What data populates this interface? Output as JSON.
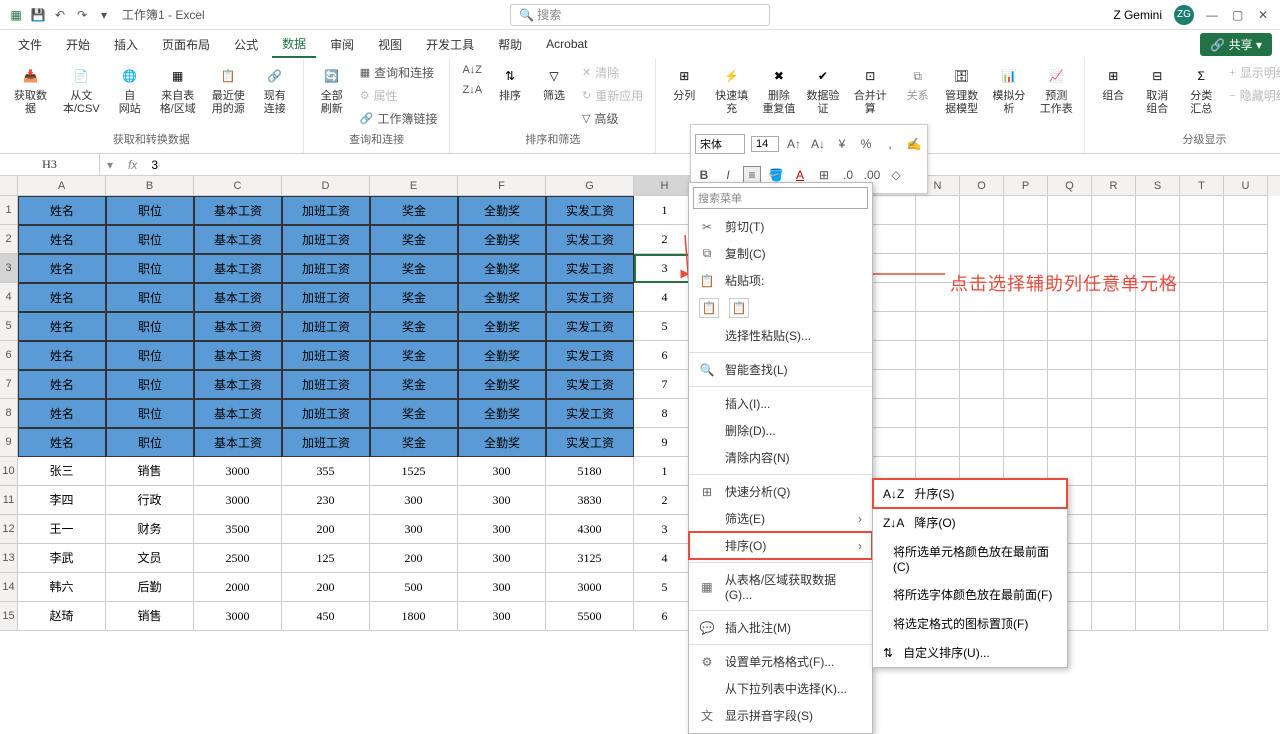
{
  "titlebar": {
    "title": "工作簿1 - Excel",
    "search_placeholder": "搜索",
    "user": "Z Gemini",
    "user_initials": "ZG"
  },
  "tabs": [
    "文件",
    "开始",
    "插入",
    "页面布局",
    "公式",
    "数据",
    "审阅",
    "视图",
    "开发工具",
    "帮助",
    "Acrobat"
  ],
  "active_tab": "数据",
  "share_label": "共享",
  "ribbon": {
    "g1_label": "获取和转换数据",
    "g1_btns": [
      "获取数\n据",
      "从文\n本/CSV",
      "自\n网站",
      "来自表\n格/区域",
      "最近使\n用的源",
      "现有\n连接"
    ],
    "g2_label": "查询和连接",
    "g2_main": "全部刷新",
    "g2_items": [
      "查询和连接",
      "属性",
      "工作簿链接"
    ],
    "g3_label": "排序和筛选",
    "g3_sort": "排序",
    "g3_filter": "筛选",
    "g3_items": [
      "清除",
      "重新应用",
      "高级"
    ],
    "g4_btns": [
      "分列",
      "快速填充",
      "删除\n重复值",
      "数据验\n证",
      "合并计算",
      "关系",
      "管理数\n据模型",
      "模拟分析",
      "预测\n工作表"
    ],
    "g5_label": "分级显示",
    "g5_btns": [
      "组合",
      "取消组合",
      "分类汇总"
    ],
    "g5_items": [
      "显示明细数据",
      "隐藏明细数据"
    ]
  },
  "floating": {
    "font": "宋体",
    "size": "14"
  },
  "namebox": {
    "cell": "H3",
    "value": "3"
  },
  "columns": [
    "A",
    "B",
    "C",
    "D",
    "E",
    "F",
    "G",
    "H",
    "I",
    "J",
    "K",
    "L",
    "M",
    "N",
    "O",
    "P",
    "Q",
    "R",
    "S",
    "T",
    "U"
  ],
  "header_row": [
    "姓名",
    "职位",
    "基本工资",
    "加班工资",
    "奖金",
    "全勤奖",
    "实发工资"
  ],
  "aux_col_top": [
    "1",
    "2",
    "3",
    "4",
    "5",
    "6",
    "7",
    "8",
    "9"
  ],
  "data_rows": [
    {
      "cells": [
        "张三",
        "销售",
        "3000",
        "355",
        "1525",
        "300",
        "5180"
      ],
      "aux": "1"
    },
    {
      "cells": [
        "李四",
        "行政",
        "3000",
        "230",
        "300",
        "300",
        "3830"
      ],
      "aux": "2"
    },
    {
      "cells": [
        "王一",
        "财务",
        "3500",
        "200",
        "300",
        "300",
        "4300"
      ],
      "aux": "3"
    },
    {
      "cells": [
        "李武",
        "文员",
        "2500",
        "125",
        "200",
        "300",
        "3125"
      ],
      "aux": "4"
    },
    {
      "cells": [
        "韩六",
        "后勤",
        "2000",
        "200",
        "500",
        "300",
        "3000"
      ],
      "aux": "5"
    },
    {
      "cells": [
        "赵琦",
        "销售",
        "3000",
        "450",
        "1800",
        "300",
        "5500"
      ],
      "aux": "6"
    }
  ],
  "context": {
    "search": "搜索菜单",
    "cut": "剪切(T)",
    "copy": "复制(C)",
    "paste": "粘贴项:",
    "paste_special": "选择性粘贴(S)...",
    "smart_lookup": "智能查找(L)",
    "insert": "插入(I)...",
    "delete": "删除(D)...",
    "clear": "清除内容(N)",
    "quick_analysis": "快速分析(Q)",
    "filter": "筛选(E)",
    "sort": "排序(O)",
    "get_data": "从表格/区域获取数据(G)...",
    "insert_comment": "插入批注(M)",
    "format_cells": "设置单元格格式(F)...",
    "pick_list": "从下拉列表中选择(K)...",
    "show_pinyin": "显示拼音字段(S)"
  },
  "submenu": {
    "asc": "升序(S)",
    "desc": "降序(O)",
    "cell_color": "将所选单元格颜色放在最前面(C)",
    "font_color": "将所选字体颜色放在最前面(F)",
    "icon": "将选定格式的图标置顶(F)",
    "custom": "自定义排序(U)..."
  },
  "annotation": "点击选择辅助列任意单元格"
}
